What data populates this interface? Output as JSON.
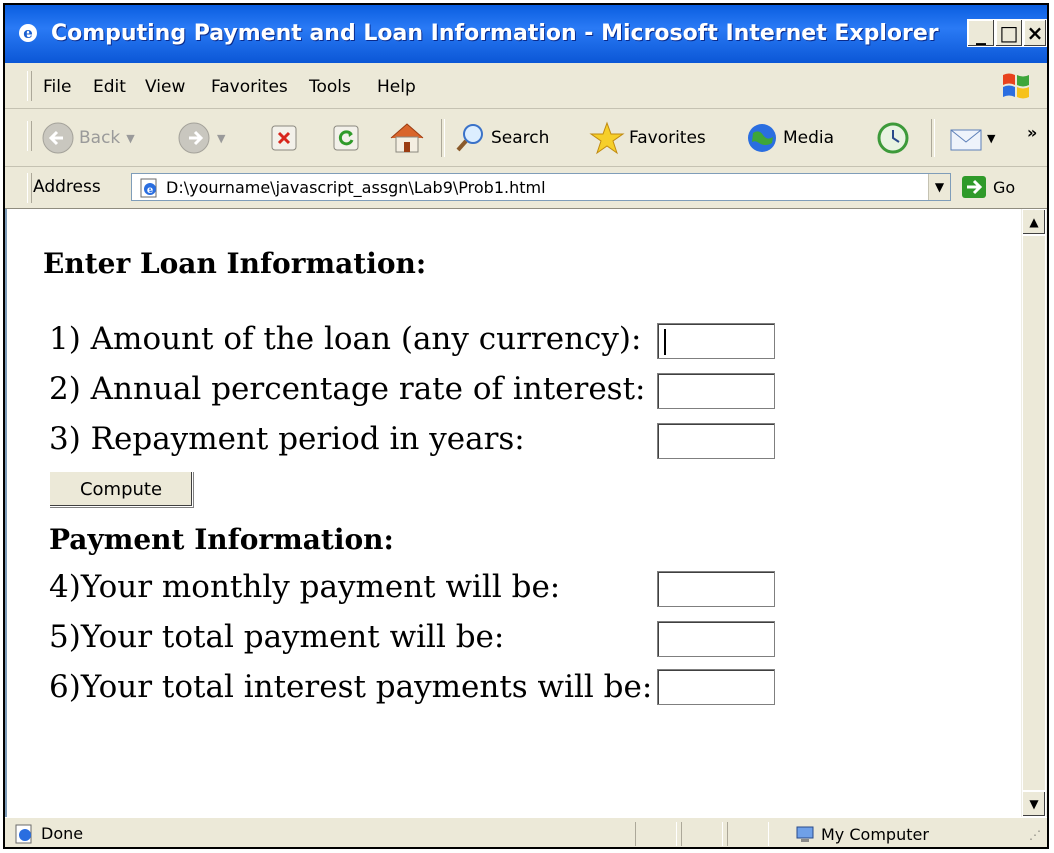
{
  "window": {
    "title": "Computing Payment and Loan Information - Microsoft Internet Explorer",
    "controls": {
      "minimize": "_",
      "maximize": "□",
      "close": "×"
    }
  },
  "menu": [
    "File",
    "Edit",
    "View",
    "Favorites",
    "Tools",
    "Help"
  ],
  "toolbar": {
    "back": "Back",
    "search": "Search",
    "favorites": "Favorites",
    "media": "Media",
    "more": "»"
  },
  "address": {
    "label": "Address",
    "url": "D:\\yourname\\javascript_assgn\\Lab9\\Prob1.html",
    "go": "Go"
  },
  "form": {
    "heading_loan": "Enter Loan Information:",
    "amount_label": "1) Amount of the loan (any currency):",
    "apr_label": "2) Annual percentage rate of interest:",
    "period_label": "3) Repayment period in years:",
    "compute_button": "Compute",
    "heading_payment": "Payment Information:",
    "monthly_label": "4)Your monthly payment will be:",
    "total_label": "5)Your total payment will be:",
    "interest_label": "6)Your total interest payments will be:",
    "amount_value": "",
    "apr_value": "",
    "period_value": "",
    "monthly_value": "",
    "total_value": "",
    "interest_value": ""
  },
  "status": {
    "text": "Done",
    "zone": "My Computer"
  },
  "colors": {
    "titlebar": "#0a5ee0",
    "chrome": "#ece9d8",
    "content_bg": "#ffffff"
  }
}
